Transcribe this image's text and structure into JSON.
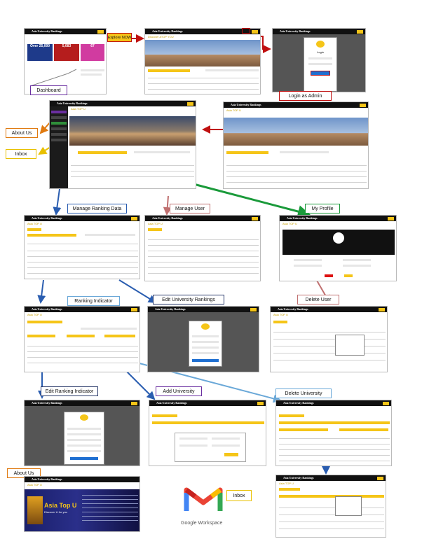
{
  "thumb_title": "Asia University Rankings",
  "thumb_subtitle": "Asia TOP U",
  "thumb_tagline": "Discover ATOP YOU",
  "dashboard_stats": [
    "Over 25,000",
    "5,083",
    "67"
  ],
  "labels": {
    "explore": "Explore NOW",
    "dashboard": "Dashboard",
    "login_admin": "Login as Admin",
    "about_us_top": "About Us",
    "inbox_top": "Inbox",
    "manage_ranking_data": "Manage Ranking Data",
    "manage_user": "Manage User",
    "my_profile": "My Profile",
    "ranking_indicator": "Ranking Indicator",
    "edit_university_rankings": "Edit University Rankings",
    "delete_user": "Delete User",
    "edit_ranking_indicator": "Edit Ranking Indicator",
    "add_university": "Add University",
    "delete_university": "Delete University",
    "about_us_bottom": "About Us",
    "inbox_bottom": "Inbox"
  },
  "about_banner": {
    "title": "Asia Top U",
    "subtitle": "Discover U for you"
  },
  "login_modal": {
    "title": "Login"
  },
  "gmail": {
    "product": "Google Workspace"
  },
  "colors": {
    "brand_yellow": "#f5c518",
    "bar_black": "#111111"
  }
}
